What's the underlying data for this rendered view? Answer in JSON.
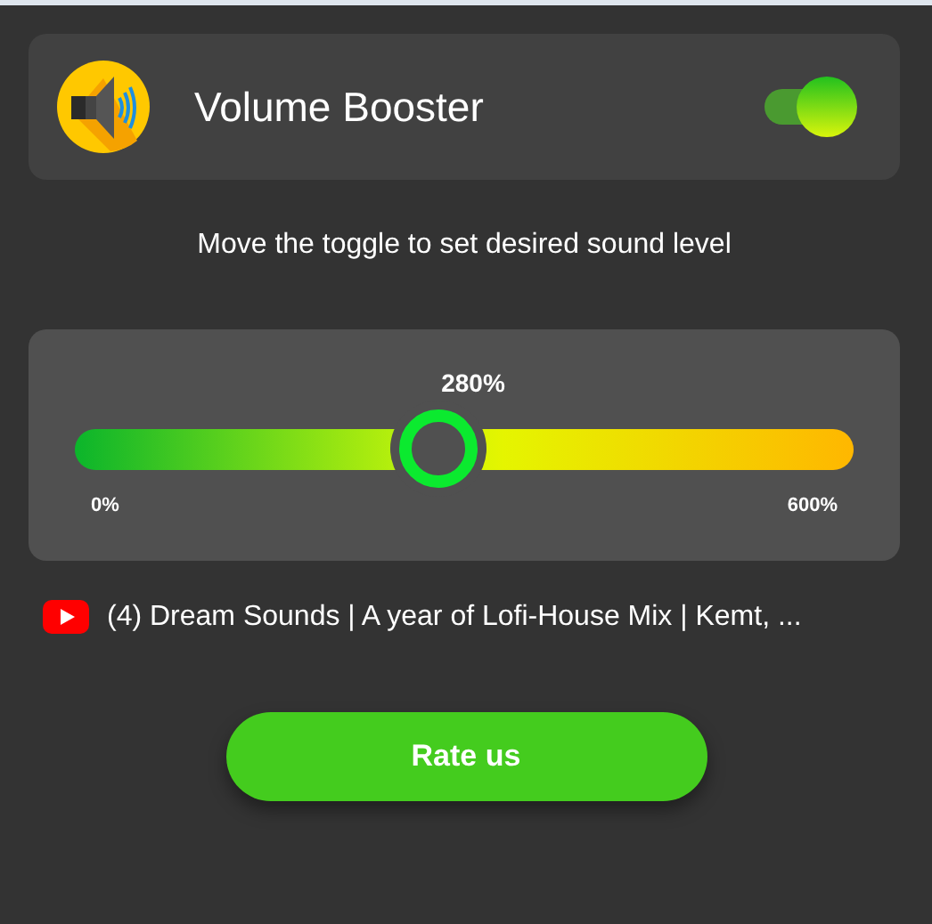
{
  "header": {
    "title": "Volume Booster",
    "enabled": true
  },
  "instruction": "Move the toggle to set desired sound level",
  "slider": {
    "reading": "280%",
    "level": 0.467,
    "min_label": "0%",
    "max_label": "600%"
  },
  "now_playing": {
    "title": "(4) Dream Sounds | A year of Lofi-House Mix | Kemt, ..."
  },
  "rate_button": "Rate us"
}
